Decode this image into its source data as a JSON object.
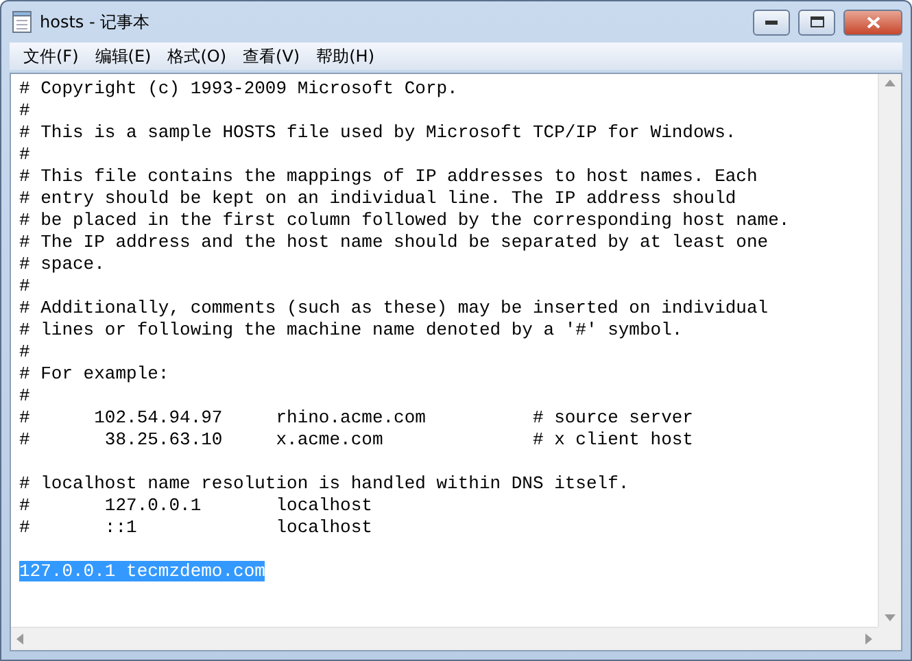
{
  "window": {
    "title": "hosts - 记事本"
  },
  "menu": [
    {
      "label": "文件(F)"
    },
    {
      "label": "编辑(E)"
    },
    {
      "label": "格式(O)"
    },
    {
      "label": "查看(V)"
    },
    {
      "label": "帮助(H)"
    }
  ],
  "editor": {
    "lines": [
      {
        "kind": "text",
        "text": "# Copyright (c) 1993-2009 Microsoft Corp.",
        "selected": false
      },
      {
        "kind": "text",
        "text": "#",
        "selected": false
      },
      {
        "kind": "text",
        "text": "# This is a sample HOSTS file used by Microsoft TCP/IP for Windows.",
        "selected": false
      },
      {
        "kind": "text",
        "text": "#",
        "selected": false
      },
      {
        "kind": "text",
        "text": "# This file contains the mappings of IP addresses to host names. Each",
        "selected": false
      },
      {
        "kind": "text",
        "text": "# entry should be kept on an individual line. The IP address should",
        "selected": false
      },
      {
        "kind": "text",
        "text": "# be placed in the first column followed by the corresponding host name.",
        "selected": false
      },
      {
        "kind": "text",
        "text": "# The IP address and the host name should be separated by at least one",
        "selected": false
      },
      {
        "kind": "text",
        "text": "# space.",
        "selected": false
      },
      {
        "kind": "text",
        "text": "#",
        "selected": false
      },
      {
        "kind": "text",
        "text": "# Additionally, comments (such as these) may be inserted on individual",
        "selected": false
      },
      {
        "kind": "text",
        "text": "# lines or following the machine name denoted by a '#' symbol.",
        "selected": false
      },
      {
        "kind": "text",
        "text": "#",
        "selected": false
      },
      {
        "kind": "text",
        "text": "# For example:",
        "selected": false
      },
      {
        "kind": "text",
        "text": "#",
        "selected": false
      },
      {
        "kind": "text",
        "text": "#      102.54.94.97     rhino.acme.com          # source server",
        "selected": false
      },
      {
        "kind": "text",
        "text": "#       38.25.63.10     x.acme.com              # x client host",
        "selected": false
      },
      {
        "kind": "blank"
      },
      {
        "kind": "text",
        "text": "# localhost name resolution is handled within DNS itself.",
        "selected": false
      },
      {
        "kind": "text",
        "text": "#       127.0.0.1       localhost",
        "selected": false
      },
      {
        "kind": "text",
        "text": "#       ::1             localhost",
        "selected": false
      },
      {
        "kind": "blank"
      },
      {
        "kind": "text",
        "text": "127.0.0.1 tecmzdemo.com",
        "selected": true
      }
    ]
  }
}
